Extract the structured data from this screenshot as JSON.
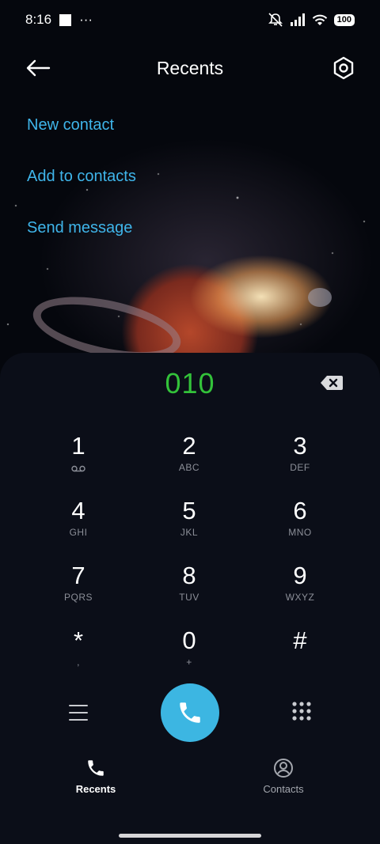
{
  "status_bar": {
    "time": "8:16",
    "dots": "···",
    "battery": "100"
  },
  "header": {
    "title": "Recents"
  },
  "actions": [
    {
      "label": "New contact"
    },
    {
      "label": "Add to contacts"
    },
    {
      "label": "Send message"
    }
  ],
  "dialer": {
    "number": "010",
    "keys": [
      {
        "digit": "1",
        "letters": ""
      },
      {
        "digit": "2",
        "letters": "ABC"
      },
      {
        "digit": "3",
        "letters": "DEF"
      },
      {
        "digit": "4",
        "letters": "GHI"
      },
      {
        "digit": "5",
        "letters": "JKL"
      },
      {
        "digit": "6",
        "letters": "MNO"
      },
      {
        "digit": "7",
        "letters": "PQRS"
      },
      {
        "digit": "8",
        "letters": "TUV"
      },
      {
        "digit": "9",
        "letters": "WXYZ"
      },
      {
        "digit": "*",
        "letters": ","
      },
      {
        "digit": "0",
        "letters": "+"
      },
      {
        "digit": "#",
        "letters": ""
      }
    ]
  },
  "nav": {
    "recents_label": "Recents",
    "contacts_label": "Contacts"
  },
  "colors": {
    "accent": "#3cb6e2",
    "number": "#33c23a",
    "link": "#3fb5ea"
  }
}
